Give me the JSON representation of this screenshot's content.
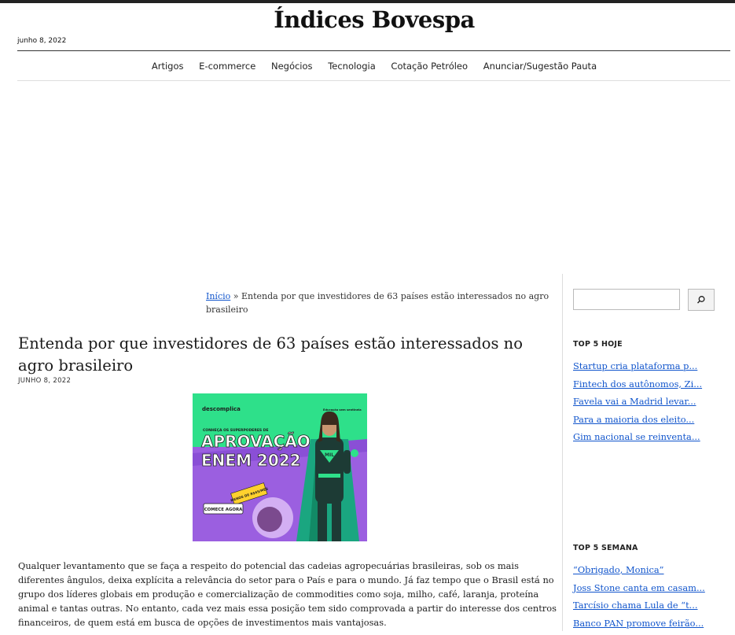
{
  "header": {
    "site_title": "Índices Bovespa",
    "date": "junho 8, 2022"
  },
  "nav": {
    "items": [
      "Artigos",
      "E-commerce",
      "Negócios",
      "Tecnologia",
      "Cotação Petróleo",
      "Anunciar/Sugestão Pauta"
    ]
  },
  "breadcrumb": {
    "home": "Início",
    "separator": " » ",
    "current": "Entenda por que investidores de 63 países estão interessados no agro brasileiro"
  },
  "post": {
    "title": "Entenda por que investidores de 63 países estão interessados no agro brasileiro",
    "date": "JUNHO 8, 2022",
    "body": "Qualquer levantamento que se faça a respeito do potencial das cadeias agropecuárias brasileiras, sob os mais diferentes ângulos, deixa explícita a relevância do setor para o País e para o mundo. Já faz tempo que o Brasil está no grupo dos líderes globais em produção e comercialização de commodities como soja, milho, café, laranja, proteína animal e tantas outras. No entanto, cada vez mais essa posição tem sido comprovada a partir do interesse dos centros financeiros, de quem está em busca de opções de investimentos mais vantajosas."
  },
  "ad": {
    "brand": "descomplica",
    "tagline": "Educação sem sentinela",
    "kicker": "CONHEÇA OS SUPERPODERES DE",
    "headline_1": "APROVAÇÃO",
    "headline_2": "ENEM 2022",
    "badge": "MENOS DE R$45/MÊS",
    "cta": "COMECE AGORA",
    "chest_logo": "MIL",
    "colors": {
      "green": "#2ee08a",
      "purple": "#9b5fe0",
      "teal": "#1aa680",
      "dark": "#1d1d1d"
    }
  },
  "sidebar": {
    "search_placeholder": "",
    "search_icon": "search-icon",
    "top_today": {
      "title": "TOP 5 HOJE",
      "items": [
        "Startup cria plataforma p...",
        "Fintech dos autônomos, Zi...",
        "Favela vai a Madrid levar...",
        "Para a maioria dos eleito...",
        "Gim nacional se reinventa..."
      ]
    },
    "top_week": {
      "title": "TOP 5 SEMANA",
      "items": [
        "“Obrigado, Monica”",
        "Joss Stone canta em casam...",
        "Tarcísio chama Lula de “t...",
        "Banco PAN promove feirão..."
      ]
    }
  },
  "colors": {
    "link": "#1155cc",
    "text": "#222222",
    "topbar": "#222222"
  }
}
